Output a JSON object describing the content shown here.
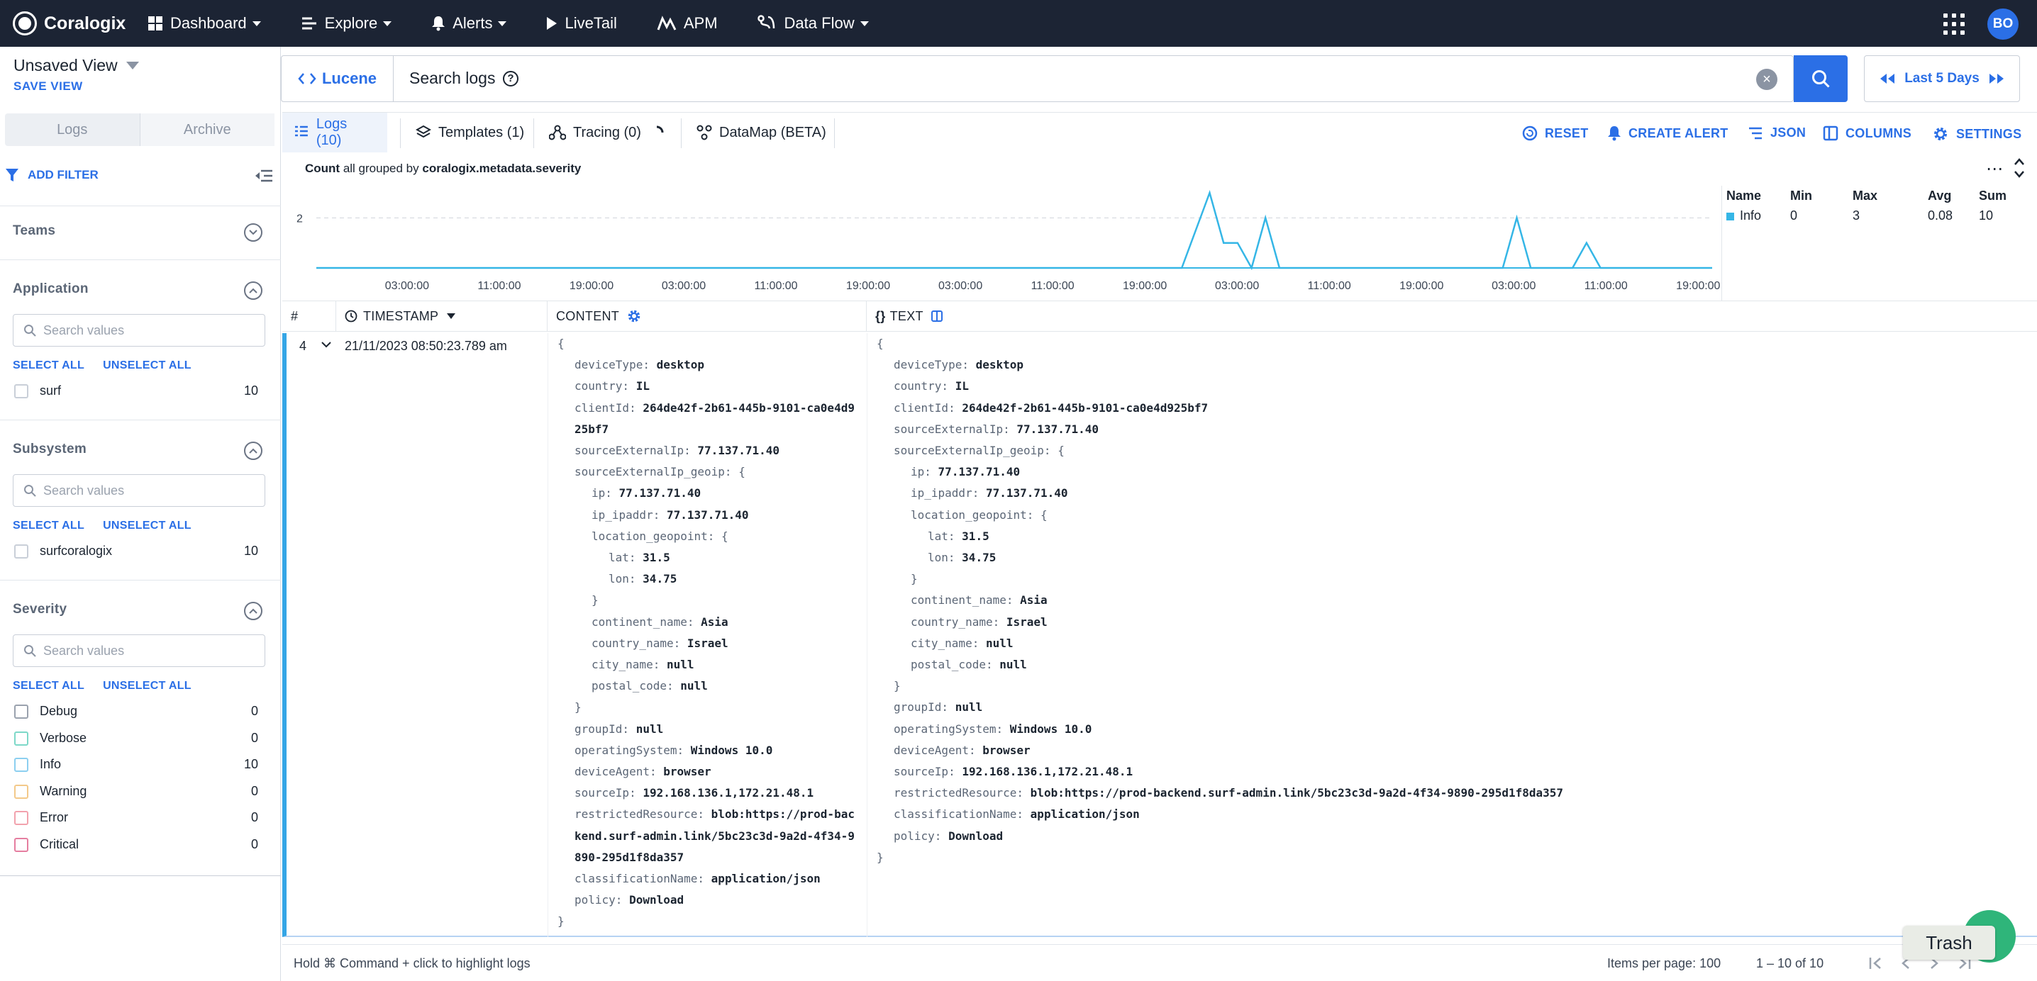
{
  "nav": {
    "brand": "Coralogix",
    "items": [
      {
        "label": "Dashboard",
        "icon": "dashboard-icon",
        "dropdown": true
      },
      {
        "label": "Explore",
        "icon": "explore-icon",
        "dropdown": true
      },
      {
        "label": "Alerts",
        "icon": "bell-icon",
        "dropdown": true
      },
      {
        "label": "LiveTail",
        "icon": "play-icon",
        "dropdown": false
      },
      {
        "label": "APM",
        "icon": "apm-icon",
        "dropdown": false
      },
      {
        "label": "Data Flow",
        "icon": "dataflow-icon",
        "dropdown": true
      }
    ],
    "avatar": "BO"
  },
  "view": {
    "title": "Unsaved View",
    "save_label": "SAVE VIEW"
  },
  "sidebar": {
    "toggle": {
      "logs": "Logs",
      "archive": "Archive"
    },
    "add_filter": "ADD FILTER",
    "select_all": "SELECT ALL",
    "unselect_all": "UNSELECT ALL",
    "search_placeholder": "Search values",
    "teams": {
      "title": "Teams"
    },
    "application": {
      "title": "Application",
      "options": [
        {
          "label": "surf",
          "count": "10"
        }
      ]
    },
    "subsystem": {
      "title": "Subsystem",
      "options": [
        {
          "label": "surfcoralogix",
          "count": "10"
        }
      ]
    },
    "severity": {
      "title": "Severity",
      "options": [
        {
          "label": "Debug",
          "count": "0",
          "color": "#9aa2ae"
        },
        {
          "label": "Verbose",
          "count": "0",
          "color": "#7dd8c8"
        },
        {
          "label": "Info",
          "count": "10",
          "color": "#8ccff0"
        },
        {
          "label": "Warning",
          "count": "0",
          "color": "#f3c98a"
        },
        {
          "label": "Error",
          "count": "0",
          "color": "#f2a2ad"
        },
        {
          "label": "Critical",
          "count": "0",
          "color": "#e57ea0"
        }
      ]
    }
  },
  "search": {
    "mode": "Lucene",
    "placeholder": "Search logs",
    "help": "?",
    "clear": "×"
  },
  "timerange": "Last 5 Days",
  "tabs": [
    {
      "label": "Logs (10)",
      "icon": "logs-icon",
      "active": true
    },
    {
      "label": "Templates (1)",
      "icon": "layers-icon",
      "active": false
    },
    {
      "label": "Tracing (0)",
      "icon": "tracing-icon",
      "active": false
    },
    {
      "label": "DataMap (BETA)",
      "icon": "datamap-icon",
      "active": false
    }
  ],
  "actions": {
    "reset": "RESET",
    "create_alert": "CREATE ALERT",
    "json": "JSON",
    "columns": "COLUMNS",
    "settings": "SETTINGS"
  },
  "aggregation": {
    "prefix": "Count",
    "middle": "all grouped by",
    "field": "coralogix.metadata.severity"
  },
  "chart_data": {
    "type": "line",
    "title": "",
    "y_ticks": [
      "2"
    ],
    "x_ticks": [
      "03:00:00",
      "11:00:00",
      "19:00:00",
      "03:00:00",
      "11:00:00",
      "19:00:00",
      "03:00:00",
      "11:00:00",
      "19:00:00",
      "03:00:00",
      "11:00:00",
      "19:00:00",
      "03:00:00",
      "11:00:00",
      "19:00:00"
    ],
    "ylim": [
      0,
      3
    ],
    "series": [
      {
        "name": "Info",
        "color": "#35b6e6",
        "x": [
          0,
          0.6,
          0.62,
          0.64,
          0.65,
          0.66,
          0.67,
          0.68,
          0.69,
          0.7,
          0.8,
          0.85,
          0.86,
          0.87,
          0.9,
          0.91,
          0.92,
          1
        ],
        "values": [
          0,
          0,
          0,
          3,
          1,
          1,
          0,
          2,
          0,
          0,
          0,
          0,
          2,
          0,
          0,
          1,
          0,
          0
        ]
      }
    ],
    "legend": {
      "headers": [
        "Name",
        "Min",
        "Max",
        "Avg",
        "Sum"
      ],
      "rows": [
        {
          "name": "Info",
          "min": "0",
          "max": "3",
          "avg": "0.08",
          "sum": "10"
        }
      ]
    }
  },
  "table": {
    "headers": {
      "num": "#",
      "timestamp": "TIMESTAMP",
      "content": "CONTENT",
      "text": "TEXT"
    },
    "row": {
      "num": "4",
      "timestamp": "21/11/2023 08:50:23.789 am"
    }
  },
  "content_json": [
    {
      "indent": 0,
      "text": "{"
    },
    {
      "indent": 1,
      "key": "deviceType:",
      "value": "desktop"
    },
    {
      "indent": 1,
      "key": "country:",
      "value": "IL"
    },
    {
      "indent": 1,
      "key": "clientId:",
      "value": "264de42f-2b61-445b-9101-ca0e4d9"
    },
    {
      "indent": 1,
      "text": "25bf7",
      "bold": true
    },
    {
      "indent": 1,
      "key": "sourceExternalIp:",
      "value": "77.137.71.40"
    },
    {
      "indent": 1,
      "key": "sourceExternalIp_geoip:",
      "value": "{",
      "light": true
    },
    {
      "indent": 2,
      "key": "ip:",
      "value": "77.137.71.40"
    },
    {
      "indent": 2,
      "key": "ip_ipaddr:",
      "value": "77.137.71.40"
    },
    {
      "indent": 2,
      "key": "location_geopoint:",
      "value": "{",
      "light": true
    },
    {
      "indent": 3,
      "key": "lat:",
      "value": "31.5"
    },
    {
      "indent": 3,
      "key": "lon:",
      "value": "34.75"
    },
    {
      "indent": 2,
      "text": "}"
    },
    {
      "indent": 2,
      "key": "continent_name:",
      "value": "Asia"
    },
    {
      "indent": 2,
      "key": "country_name:",
      "value": "Israel"
    },
    {
      "indent": 2,
      "key": "city_name:",
      "value": "null"
    },
    {
      "indent": 2,
      "key": "postal_code:",
      "value": "null"
    },
    {
      "indent": 1,
      "text": "}"
    },
    {
      "indent": 1,
      "key": "groupId:",
      "value": "null"
    },
    {
      "indent": 1,
      "key": "operatingSystem:",
      "value": "Windows 10.0"
    },
    {
      "indent": 1,
      "key": "deviceAgent:",
      "value": "browser"
    },
    {
      "indent": 1,
      "key": "sourceIp:",
      "value": "192.168.136.1,172.21.48.1"
    },
    {
      "indent": 1,
      "key": "restrictedResource:",
      "value": "blob:https://prod-bac"
    },
    {
      "indent": 1,
      "text": "kend.surf-admin.link/5bc23c3d-9a2d-4f34-9",
      "bold": true
    },
    {
      "indent": 1,
      "text": "890-295d1f8da357",
      "bold": true
    },
    {
      "indent": 1,
      "key": "classificationName:",
      "value": "application/json"
    },
    {
      "indent": 1,
      "key": "policy:",
      "value": "Download"
    },
    {
      "indent": 0,
      "text": "}"
    }
  ],
  "text_json": [
    {
      "indent": 0,
      "text": "{"
    },
    {
      "indent": 1,
      "key": "deviceType:",
      "value": "desktop"
    },
    {
      "indent": 1,
      "key": "country:",
      "value": "IL"
    },
    {
      "indent": 1,
      "key": "clientId:",
      "value": "264de42f-2b61-445b-9101-ca0e4d925bf7"
    },
    {
      "indent": 1,
      "key": "sourceExternalIp:",
      "value": "77.137.71.40"
    },
    {
      "indent": 1,
      "key": "sourceExternalIp_geoip:",
      "value": "{",
      "light": true
    },
    {
      "indent": 2,
      "key": "ip:",
      "value": "77.137.71.40"
    },
    {
      "indent": 2,
      "key": "ip_ipaddr:",
      "value": "77.137.71.40"
    },
    {
      "indent": 2,
      "key": "location_geopoint:",
      "value": "{",
      "light": true
    },
    {
      "indent": 3,
      "key": "lat:",
      "value": "31.5"
    },
    {
      "indent": 3,
      "key": "lon:",
      "value": "34.75"
    },
    {
      "indent": 2,
      "text": "}"
    },
    {
      "indent": 2,
      "key": "continent_name:",
      "value": "Asia"
    },
    {
      "indent": 2,
      "key": "country_name:",
      "value": "Israel"
    },
    {
      "indent": 2,
      "key": "city_name:",
      "value": "null"
    },
    {
      "indent": 2,
      "key": "postal_code:",
      "value": "null"
    },
    {
      "indent": 1,
      "text": "}"
    },
    {
      "indent": 1,
      "key": "groupId:",
      "value": "null"
    },
    {
      "indent": 1,
      "key": "operatingSystem:",
      "value": "Windows 10.0"
    },
    {
      "indent": 1,
      "key": "deviceAgent:",
      "value": "browser"
    },
    {
      "indent": 1,
      "key": "sourceIp:",
      "value": "192.168.136.1,172.21.48.1"
    },
    {
      "indent": 1,
      "key": "restrictedResource:",
      "value": "blob:https://prod-backend.surf-admin.link/5bc23c3d-9a2d-4f34-9890-295d1f8da357"
    },
    {
      "indent": 1,
      "key": "classificationName:",
      "value": "application/json"
    },
    {
      "indent": 1,
      "key": "policy:",
      "value": "Download"
    },
    {
      "indent": 0,
      "text": "}"
    }
  ],
  "footer": {
    "hint": "Hold ⌘ Command + click to highlight logs",
    "per_page": "Items per page: 100",
    "range": "1 – 10 of 10"
  },
  "trash": "Trash"
}
